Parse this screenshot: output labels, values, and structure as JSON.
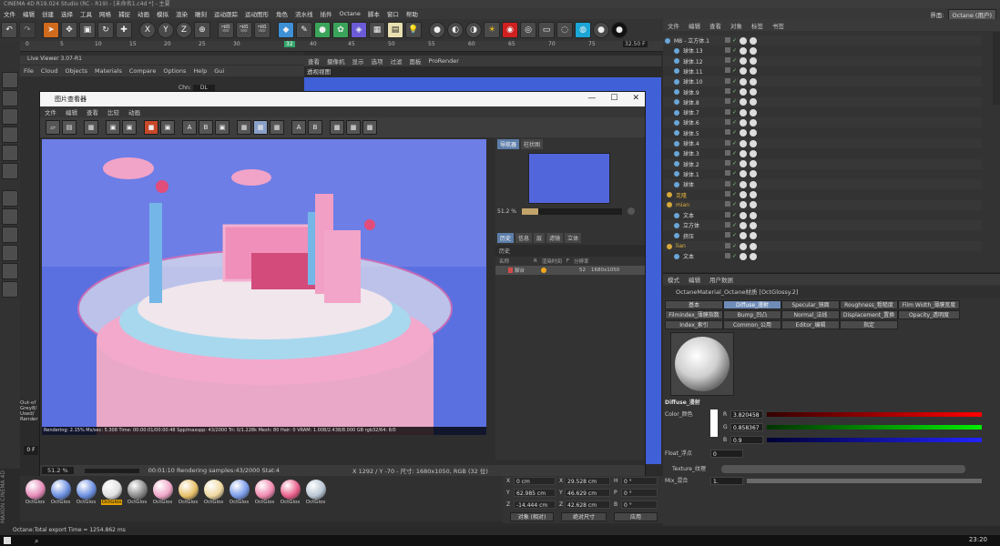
{
  "app": {
    "title": "CINEMA 4D R19.024 Studio (RC - R19) - [未命名1.c4d *] - 主要",
    "layout_label": "界面:",
    "layout_value": "Octane (用户)"
  },
  "menu": [
    "文件",
    "编辑",
    "创建",
    "选择",
    "工具",
    "网格",
    "捕捉",
    "动画",
    "模拟",
    "渲染",
    "雕刻",
    "运动跟踪",
    "运动图形",
    "角色",
    "流水线",
    "插件",
    "Octane",
    "脚本",
    "窗口",
    "帮助"
  ],
  "timeline": {
    "ticks": [
      "0",
      "5",
      "10",
      "15",
      "20",
      "25",
      "30",
      "35",
      "40",
      "45",
      "50",
      "55",
      "60",
      "65",
      "70",
      "75"
    ],
    "current": "32",
    "end_field": "32.50 F"
  },
  "live_viewer": {
    "title": "Live Viewer 3.07-R1",
    "menu": [
      "File",
      "Cloud",
      "Objects",
      "Materials",
      "Compare",
      "Options",
      "Help",
      "Gui"
    ],
    "channel_label": "Chn:",
    "channel_value": "DL"
  },
  "viewport": {
    "menu": [
      "查看",
      "摄像机",
      "显示",
      "选项",
      "过滤",
      "面板",
      "ProRender"
    ],
    "name": "透视视图"
  },
  "picture_viewer": {
    "title": "图片查看器",
    "menu": [
      "文件",
      "编辑",
      "查看",
      "比较",
      "动画"
    ],
    "render_status": "Rendering: 2.15%  Ms/sec: 5.308  Time: 00:00:01/00:00:48  Spp/maxspp: 43/2000  Tri: 0/1.228k  Mesh: 80  Hair: 0  VRAM: 1.008/2.438/8.000  GB  rgb32/64: 8/0",
    "nav_tabs": [
      "导航器",
      "柱状图"
    ],
    "nav_zoom": "51.2 %",
    "hist_tabs": [
      "历史",
      "信息",
      "层",
      "滤镜",
      "立体"
    ],
    "history_title": "历史",
    "history_cols": [
      "名称",
      "R",
      "渲染时间",
      "F",
      "分辨率"
    ],
    "history_row": {
      "name": "脚台",
      "frame": "52",
      "res": "1680x1050"
    },
    "zoom": "51.2 %",
    "time": "00:01:10 Rendering samples:43/2000 Stat:4",
    "coords": "X 1292 / Y -70 - 尺寸: 1680x1050, RGB (32 位)"
  },
  "left_overlay": [
    "Out-of",
    "Grey8/",
    "Used/",
    "Render"
  ],
  "frame_field": "0 F",
  "object_manager": {
    "tabs": [
      "文件",
      "编辑",
      "查看",
      "对象",
      "标签",
      "书签"
    ],
    "rows": [
      "MB - 立方体.1",
      "球体.13",
      "球体.12",
      "球体.11",
      "球体.10",
      "球体.9",
      "球体.8",
      "球体.7",
      "球体.6",
      "球体.5",
      "球体.4",
      "球体.3",
      "球体.2",
      "球体.1",
      "球体",
      "克隆",
      "mian",
      "文本",
      "立方体",
      "挤压",
      "lian",
      "文本"
    ]
  },
  "material_editor": {
    "tabs": [
      "模式",
      "编辑",
      "用户数据"
    ],
    "name": "OctaneMaterial_Octane材质 [OctGlossy.2]",
    "channel_tabs": [
      [
        "基本",
        "Diffuse_漫射",
        "Specular_镜面",
        "Roughness_粗糙度",
        "Film Width_薄膜宽度"
      ],
      [
        "Filmindex_薄膜指数",
        "Bump_凹凸",
        "Normal_法线",
        "Displacement_置换",
        "Opacity_透明度"
      ],
      [
        "Index_索引",
        "Common_公用",
        "Editor_编辑",
        "指定"
      ]
    ],
    "section": "Diffuse_漫射",
    "color_label": "Color_颜色",
    "r": "3.820458",
    "g": "0.858367",
    "b": "0.9",
    "float_label": "Float_浮点",
    "float_value": "0",
    "texture_label": "Texture_纹理",
    "mix_label": "Mix_混合",
    "mix_value": "1."
  },
  "coords": {
    "x": "0 cm",
    "y": "62.985 cm",
    "z": "-14.444 cm",
    "sx": "29.528 cm",
    "sy": "46.629 cm",
    "sz": "42.628 cm",
    "h": "0 °",
    "p": "0 °",
    "b": "0 °",
    "mode": "对象 (相对)",
    "size_mode": "绝对尺寸",
    "apply": "应用"
  },
  "materials": [
    {
      "label": "OctGlos",
      "color": "#e58ab8"
    },
    {
      "label": "OctGlos",
      "color": "#6b8fe0"
    },
    {
      "label": "OctGlos",
      "color": "#6b8fe0"
    },
    {
      "label": "OctGlos",
      "color": "#e0e0e0"
    },
    {
      "label": "OctGlos",
      "color": "#8a8a8a"
    },
    {
      "label": "OctGlos",
      "color": "#f0a7c8"
    },
    {
      "label": "OctGlos",
      "color": "#e8c06a"
    },
    {
      "label": "OctGlos",
      "color": "#efd9a0"
    },
    {
      "label": "OctGlos",
      "color": "#7a9be8"
    },
    {
      "label": "OctGlos",
      "color": "#f08ab0"
    },
    {
      "label": "OctGlos",
      "color": "#e85f8a"
    },
    {
      "label": "OctGlos",
      "color": "#b9c6d4"
    }
  ],
  "status": "Octane:Total export Time = 1254.862 ms",
  "clock": "23:20"
}
